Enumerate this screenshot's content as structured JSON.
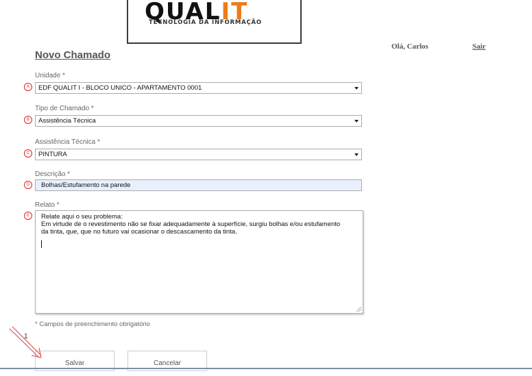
{
  "header": {
    "logo_main": "QUAL",
    "logo_accent": "IT",
    "logo_subtitle": "TECNOLOGIA DA INFORMAÇÃO",
    "greeting": "Olá, Carlos",
    "logout_label": "Sair"
  },
  "form": {
    "title": "Novo Chamado",
    "unidade": {
      "marker": "A",
      "label": "Unidade *",
      "value": "EDF QUALIT I - BLOCO UNICO - APARTAMENTO 0001"
    },
    "tipo": {
      "marker": "B",
      "label": "Tipo de Chamado *",
      "value": "Assistência Técnica"
    },
    "assistencia": {
      "marker": "C",
      "label": "Assistência Técnica *",
      "value": "PINTURA"
    },
    "descricao": {
      "marker": "D",
      "label": "Descrição *",
      "value": "Bolhas/Estufamento na parede"
    },
    "relato": {
      "marker": "E",
      "label": "Relato *",
      "line1": "Relate aqui o seu problema:",
      "line2": "Em virtude de o revestimento não se fixar adequadamente à superfície, surgiu bolhas e/ou estufamento",
      "line3": "da tinta, que, que no futuro vai ocasionar o descascamento da tinta."
    },
    "required_note": "* Campos de preenchimento obrigatório",
    "save_label": "Salvar",
    "cancel_label": "Cancelar"
  },
  "annotation": {
    "step_number": "1"
  },
  "colors": {
    "accent": "#f07a17",
    "marker": "#dd2222",
    "input_fill": "#e8f0fe"
  }
}
